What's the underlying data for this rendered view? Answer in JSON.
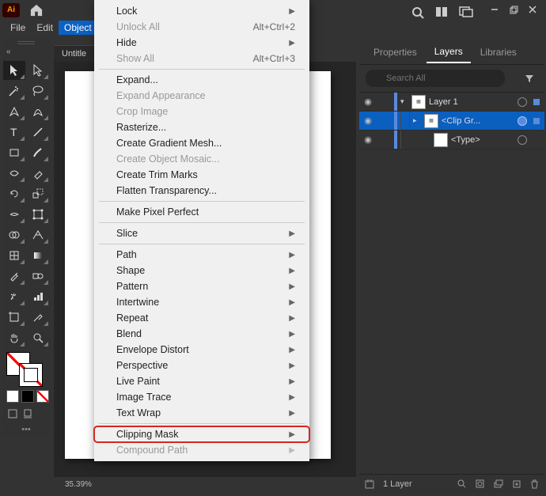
{
  "app": {
    "brand": "Ai"
  },
  "menubar": {
    "file": "File",
    "edit": "Edit",
    "object": "Object"
  },
  "doctab": {
    "name": "Untitle"
  },
  "status": {
    "zoom": "35.39%"
  },
  "toolbar_tooltips": {
    "selection": "Selection Tool",
    "direct": "Direct Selection Tool"
  },
  "dropdown": {
    "lock": "Lock",
    "unlockAll": "Unlock All",
    "unlockAll_sc": "Alt+Ctrl+2",
    "hide": "Hide",
    "showAll": "Show All",
    "showAll_sc": "Alt+Ctrl+3",
    "expand": "Expand...",
    "expandAppearance": "Expand Appearance",
    "cropImage": "Crop Image",
    "rasterize": "Rasterize...",
    "gradientMesh": "Create Gradient Mesh...",
    "objectMosaic": "Create Object Mosaic...",
    "trimMarks": "Create Trim Marks",
    "flatten": "Flatten Transparency...",
    "pixelPerfect": "Make Pixel Perfect",
    "slice": "Slice",
    "path": "Path",
    "shape": "Shape",
    "pattern": "Pattern",
    "intertwine": "Intertwine",
    "repeat": "Repeat",
    "blend": "Blend",
    "envelope": "Envelope Distort",
    "perspective": "Perspective",
    "livePaint": "Live Paint",
    "imageTrace": "Image Trace",
    "textWrap": "Text Wrap",
    "clippingMask": "Clipping Mask",
    "compoundPath": "Compound Path"
  },
  "rpanel": {
    "tabs": {
      "properties": "Properties",
      "layers": "Layers",
      "libraries": "Libraries"
    },
    "searchPlaceholder": "Search All",
    "layers": {
      "l1": "Layer 1",
      "l2": "<Clip Gr...",
      "l3": "<Type>"
    },
    "footer": {
      "count": "1 Layer"
    }
  }
}
